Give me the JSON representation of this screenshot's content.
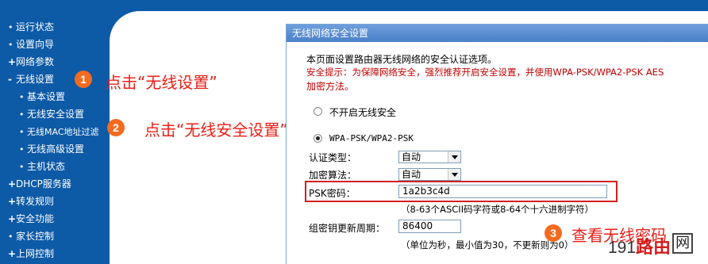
{
  "sidebar": {
    "items": [
      {
        "label": "运行状态",
        "bullet": "•",
        "level": 0
      },
      {
        "label": "设置向导",
        "bullet": "•",
        "level": 0
      },
      {
        "label": "网络参数",
        "bullet": "+",
        "level": 0
      },
      {
        "label": "无线设置",
        "bullet": "-",
        "level": 0
      },
      {
        "label": "基本设置",
        "bullet": "•",
        "level": 1
      },
      {
        "label": "无线安全设置",
        "bullet": "•",
        "level": 1
      },
      {
        "label": "无线MAC地址过滤",
        "bullet": "•",
        "level": 1
      },
      {
        "label": "无线高级设置",
        "bullet": "•",
        "level": 1
      },
      {
        "label": "主机状态",
        "bullet": "•",
        "level": 1
      },
      {
        "label": "DHCP服务器",
        "bullet": "+",
        "level": 0
      },
      {
        "label": "转发规则",
        "bullet": "+",
        "level": 0
      },
      {
        "label": "安全功能",
        "bullet": "+",
        "level": 0
      },
      {
        "label": "家长控制",
        "bullet": "•",
        "level": 0
      },
      {
        "label": "上网控制",
        "bullet": "+",
        "level": 0
      }
    ]
  },
  "annotations": [
    {
      "num": "1",
      "text": "点击“无线设置”"
    },
    {
      "num": "2",
      "text": "点击“无线安全设置”"
    },
    {
      "num": "3",
      "text": "查看无线密码"
    }
  ],
  "panel": {
    "title": "无线网络安全设置",
    "intro": "本页面设置路由器无线网络的安全认证选项。",
    "warning_line1": "安全提示：为保障网络安全，强烈推荐开启安全设置，并使用WPA-PSK/WPA2-PSK AES",
    "warning_line2": "加密方法。",
    "option_off": "不开启无线安全",
    "option_wpa": "WPA-PSK/WPA2-PSK",
    "auth_label": "认证类型：",
    "auth_value": "自动",
    "enc_label": "加密算法：",
    "enc_value": "自动",
    "psk_label": "PSK密码：",
    "psk_value": "1a2b3c4d",
    "psk_hint": "（8-63个ASCII码字符或8-64个十六进制字符）",
    "renew_label": "组密钥更新周期：",
    "renew_value": "86400",
    "renew_hint": "（单位为秒，最小值为30，不更新则为0）"
  },
  "watermark": {
    "num": "191",
    "cn": "路由",
    "logo": "网"
  },
  "colors": {
    "nav_bg": "#0d5aa7",
    "title_bar": "#4a80c8",
    "annotation": "#e8201a",
    "badge": "#f26b21"
  }
}
